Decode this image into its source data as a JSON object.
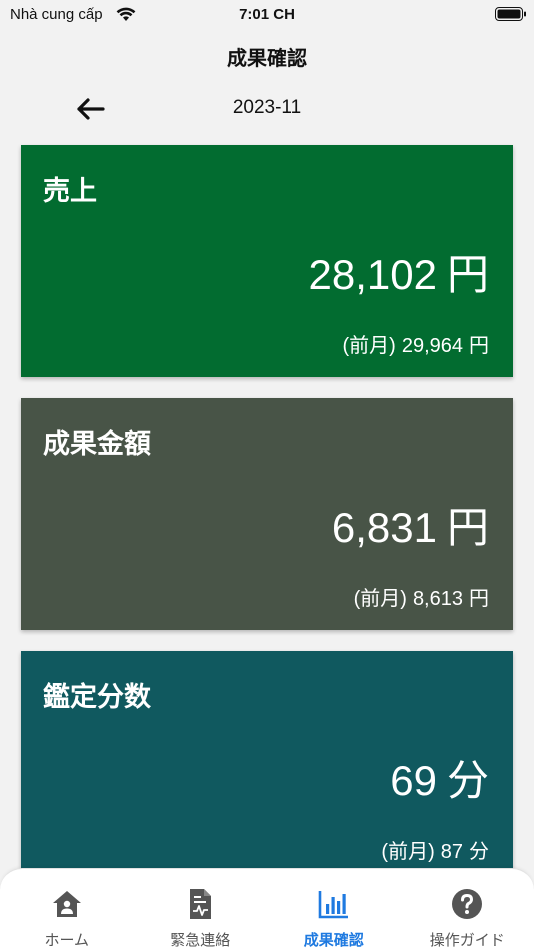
{
  "status_bar": {
    "carrier": "Nhà cung cấp",
    "time": "7:01 CH"
  },
  "header": {
    "title": "成果確認",
    "month": "2023-11"
  },
  "cards": [
    {
      "title": "売上",
      "value": "28,102",
      "unit": "円",
      "prev_label": "(前月)",
      "prev_value": "29,964",
      "prev_unit": "円",
      "color": "#026c30"
    },
    {
      "title": "成果金額",
      "value": "6,831",
      "unit": "円",
      "prev_label": "(前月)",
      "prev_value": "8,613",
      "prev_unit": "円",
      "color": "#485447"
    },
    {
      "title": "鑑定分数",
      "value": "69",
      "unit": "分",
      "prev_label": "(前月)",
      "prev_value": "87",
      "prev_unit": "分",
      "color": "#10595f"
    }
  ],
  "tab_bar": {
    "active_color": "#1f7ae0",
    "items": [
      {
        "label": "ホーム",
        "icon": "home-icon"
      },
      {
        "label": "緊急連絡",
        "icon": "document-icon"
      },
      {
        "label": "成果確認",
        "icon": "bar-chart-icon"
      },
      {
        "label": "操作ガイド",
        "icon": "help-icon"
      }
    ]
  }
}
